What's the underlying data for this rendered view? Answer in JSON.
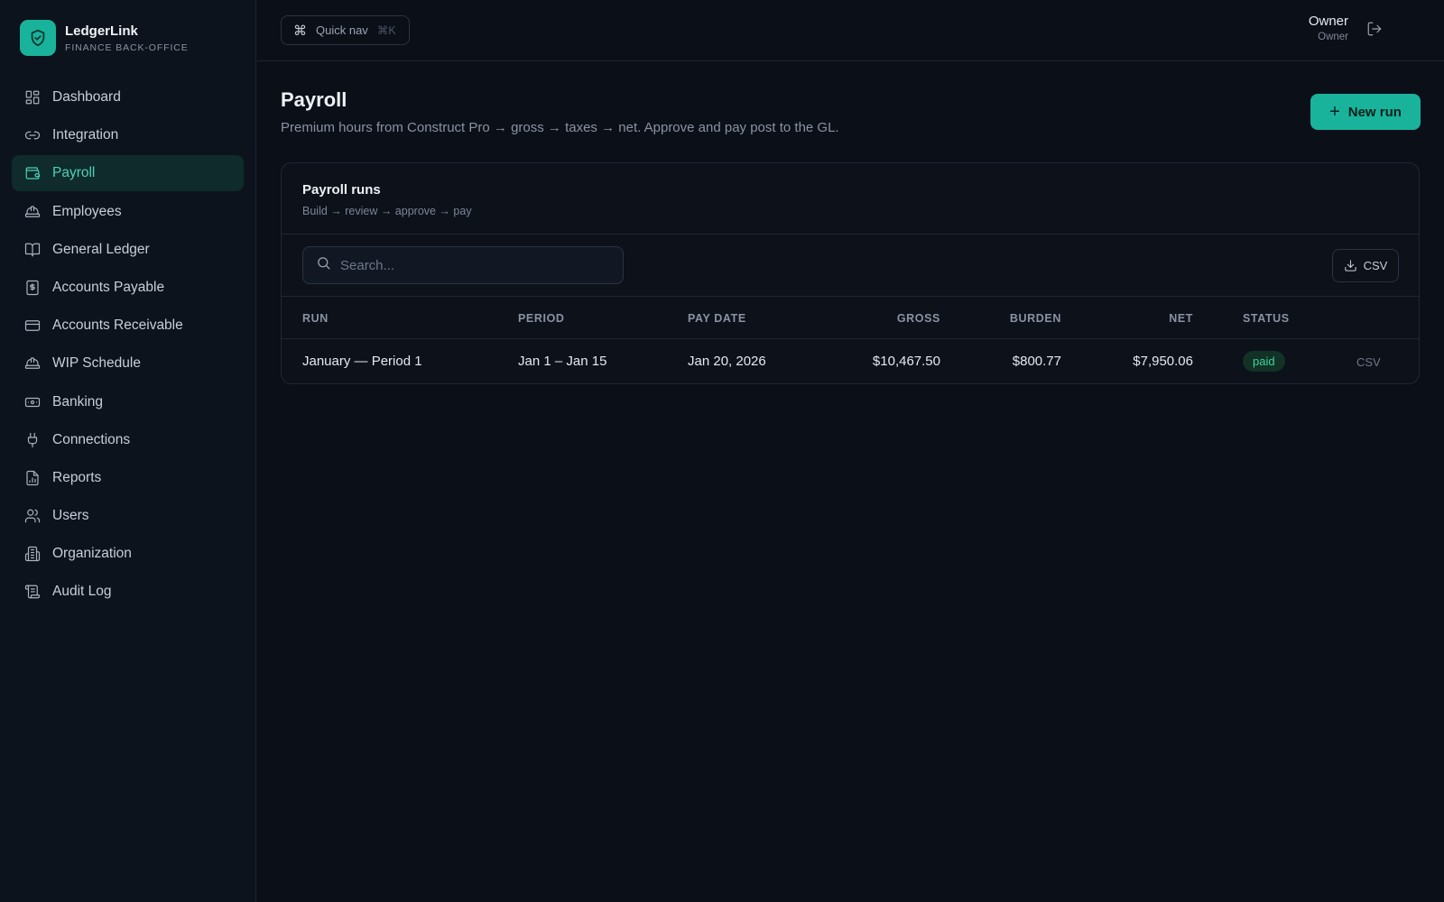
{
  "brand": {
    "name": "LedgerLink",
    "subtitle": "FINANCE BACK-OFFICE",
    "logo_icon": "shield-icon",
    "accent": "#19b39c"
  },
  "sidebar": {
    "items": [
      {
        "label": "Dashboard",
        "icon": "grid-icon"
      },
      {
        "label": "Integration",
        "icon": "link-icon"
      },
      {
        "label": "Payroll",
        "icon": "wallet-icon",
        "active": true
      },
      {
        "label": "Employees",
        "icon": "hard-hat-icon"
      },
      {
        "label": "General Ledger",
        "icon": "book-icon"
      },
      {
        "label": "Accounts Payable",
        "icon": "receipt-icon"
      },
      {
        "label": "Accounts Receivable",
        "icon": "credit-card-icon"
      },
      {
        "label": "WIP Schedule",
        "icon": "hard-hat-icon"
      },
      {
        "label": "Banking",
        "icon": "banknote-icon"
      },
      {
        "label": "Connections",
        "icon": "plug-icon"
      },
      {
        "label": "Reports",
        "icon": "report-icon"
      },
      {
        "label": "Users",
        "icon": "users-icon"
      },
      {
        "label": "Organization",
        "icon": "building-icon"
      },
      {
        "label": "Audit Log",
        "icon": "scroll-icon"
      }
    ]
  },
  "topbar": {
    "quick_nav_label": "Quick nav",
    "quick_nav_shortcut": "⌘K",
    "user_name": "Owner",
    "user_role": "Owner"
  },
  "page": {
    "title": "Payroll",
    "subtitle": "Premium hours from Construct Pro → gross → taxes → net. Approve and pay post to the GL.",
    "new_run_label": "New run"
  },
  "card": {
    "title": "Payroll runs",
    "subtitle": "Build → review → approve → pay",
    "search_placeholder": "Search...",
    "search_value": "",
    "csv_label": "CSV",
    "columns": [
      "RUN",
      "PERIOD",
      "PAY DATE",
      "GROSS",
      "BURDEN",
      "NET",
      "STATUS"
    ],
    "rows": [
      {
        "run": "January — Period 1",
        "period": "Jan 1 – Jan 15",
        "pay_date": "Jan 20, 2026",
        "gross": "$10,467.50",
        "burden": "$800.77",
        "net": "$7,950.06",
        "status": "paid",
        "status_color": "#3fd39a",
        "action": "CSV"
      }
    ]
  }
}
